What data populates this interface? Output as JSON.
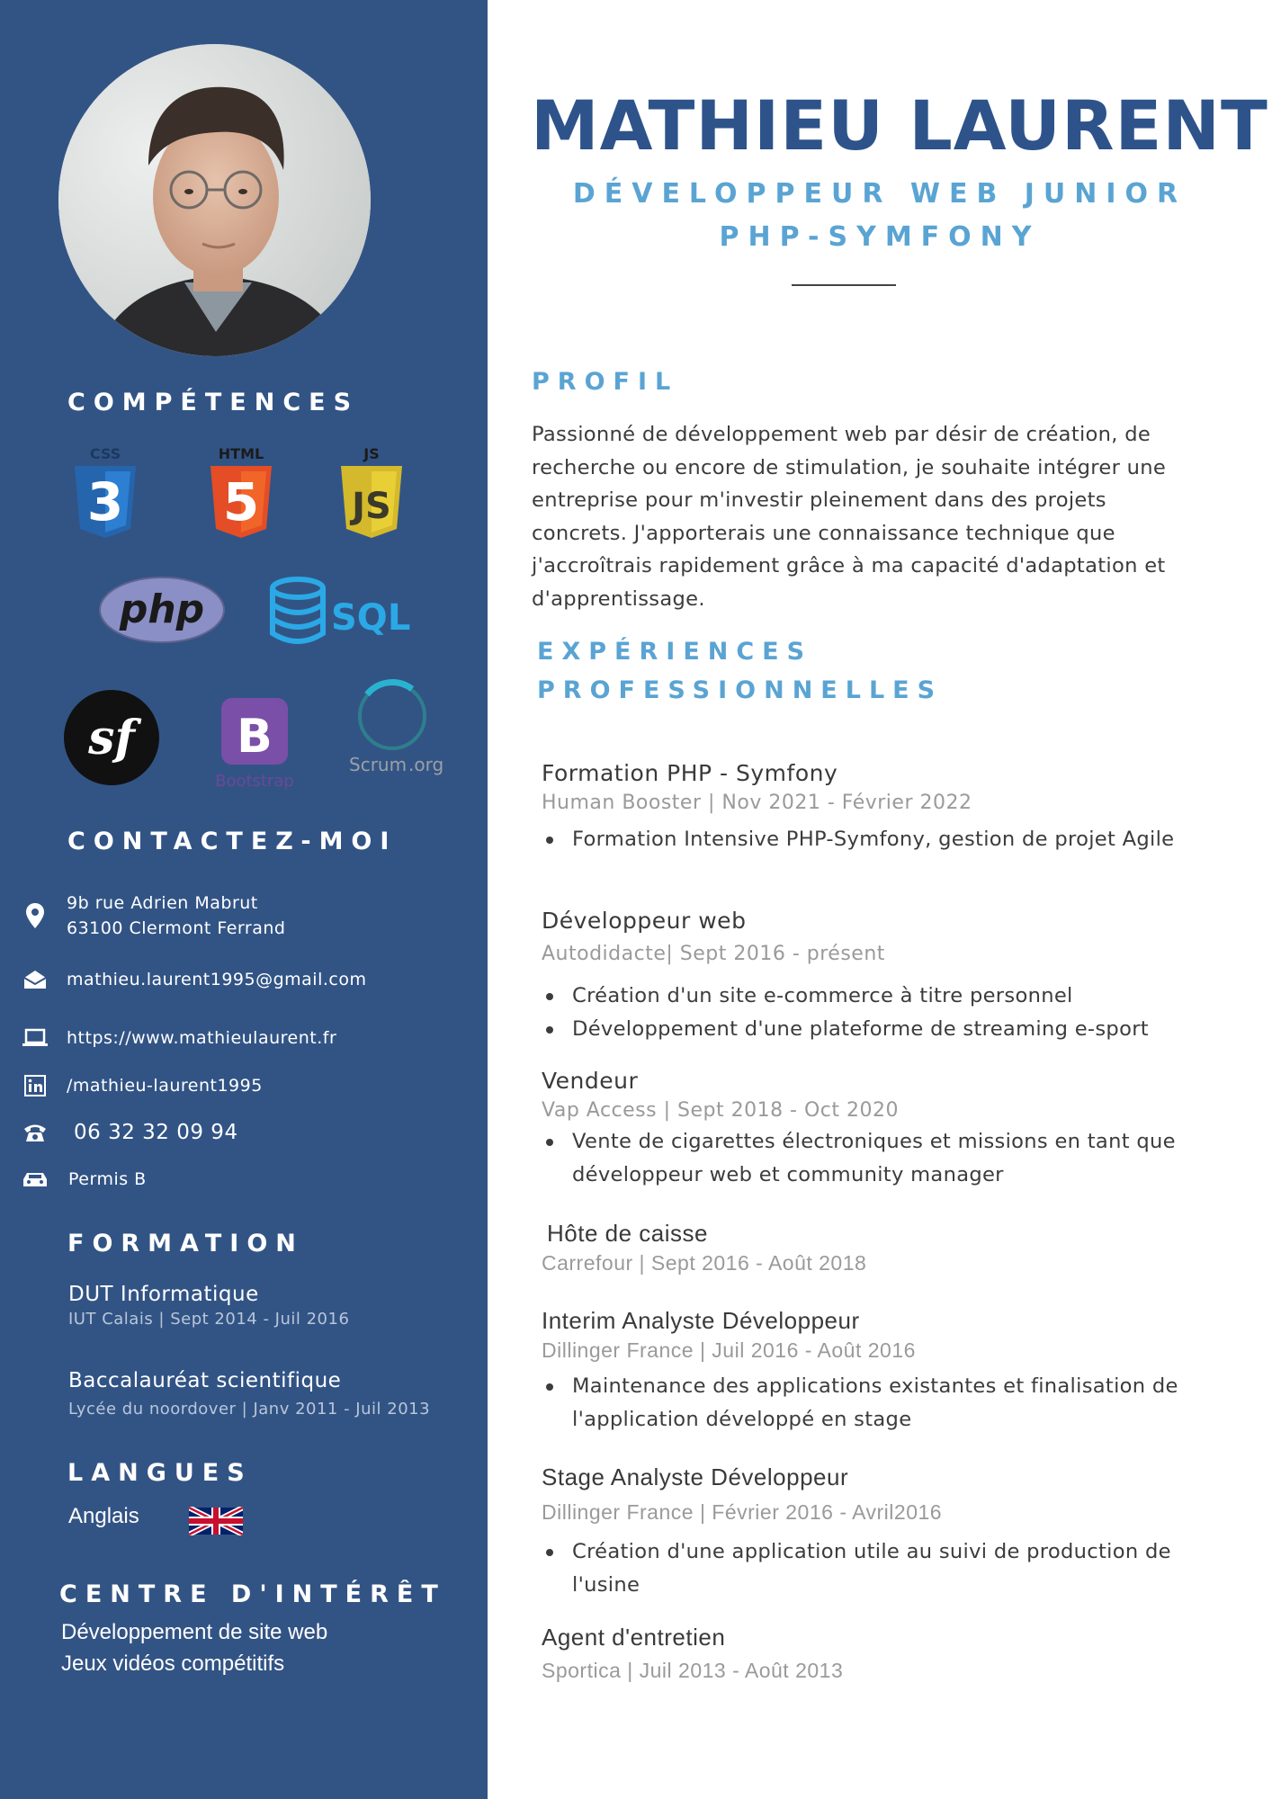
{
  "header": {
    "name": "MATHIEU LAURENT",
    "subtitle_line1": "DÉVELOPPEUR WEB JUNIOR",
    "subtitle_line2": "PHP-SYMFONY"
  },
  "sidebar": {
    "competences_heading": "COMPÉTENCES",
    "logos": {
      "css_label": "CSS",
      "css_digit": "3",
      "html_label": "HTML",
      "html_digit": "5",
      "js_label": "JS",
      "js_mark": "JS",
      "php": "php",
      "sql": "SQL",
      "symfony": "sf",
      "bootstrap_letter": "B",
      "bootstrap_word": "Bootstrap",
      "scrum": "Scrum",
      "scrum_suffix": ".org"
    },
    "contact_heading": "CONTACTEZ-MOI",
    "contact": {
      "address_line1": "9b rue Adrien Mabrut",
      "address_line2": "63100 Clermont Ferrand",
      "email": "mathieu.laurent1995@gmail.com",
      "website": "https://www.mathieulaurent.fr",
      "linkedin": "/mathieu-laurent1995",
      "phone": "06 32 32 09 94",
      "licence": "Permis B"
    },
    "formation_heading": "FORMATION",
    "formation": [
      {
        "title": "DUT Informatique",
        "sub": "IUT Calais | Sept 2014 - Juil 2016"
      },
      {
        "title": "Baccalauréat scientifique",
        "sub": "Lycée du noordover | Janv 2011 - Juil 2013"
      }
    ],
    "langues_heading": "LANGUES",
    "langue": "Anglais",
    "interets_heading": "CENTRE D'INTÉRÊT",
    "interets": [
      "Développement de site web",
      "Jeux vidéos compétitifs"
    ]
  },
  "profil": {
    "heading": "PROFIL",
    "text": "Passionné de développement web par désir de création, de recherche ou encore de stimulation, je souhaite intégrer une entreprise pour m'investir pleinement dans des projets concrets. J'apporterais une connaissance technique que j'accroîtrais rapidement grâce à ma capacité d'adaptation et d'apprentissage."
  },
  "experiences": {
    "heading_line1": "EXPÉRIENCES",
    "heading_line2": "PROFESSIONNELLES",
    "jobs": [
      {
        "title": "Formation PHP - Symfony",
        "meta": "Human Booster | Nov 2021 - Février 2022",
        "bullets": [
          "Formation Intensive PHP-Symfony, gestion de projet Agile"
        ]
      },
      {
        "title": "Développeur web",
        "meta": "Autodidacte| Sept 2016 - présent",
        "bullets": [
          "Création d'un site e-commerce à titre personnel",
          "Développement d'une plateforme de streaming e-sport"
        ]
      },
      {
        "title": "Vendeur",
        "meta": "Vap Access | Sept 2018 - Oct 2020",
        "bullets": [
          "Vente de cigarettes électroniques et missions en tant que développeur web et community manager"
        ]
      },
      {
        "title": "Hôte de caisse",
        "meta": "Carrefour | Sept 2016 - Août 2018",
        "bullets": []
      },
      {
        "title": "Interim Analyste Développeur",
        "meta": "Dillinger France | Juil 2016 - Août 2016",
        "bullets": [
          "Maintenance des applications existantes et finalisation de l'application développé en stage"
        ]
      },
      {
        "title": "Stage Analyste Développeur",
        "meta": "Dillinger France | Février 2016 - Avril2016",
        "bullets": [
          "Création d'une application utile au suivi de production de l'usine"
        ]
      },
      {
        "title": "Agent d'entretien",
        "meta": "Sportica | Juil 2013 - Août 2013",
        "bullets": []
      }
    ]
  },
  "colors": {
    "sidebar": "#325485",
    "name": "#2d538a",
    "accent": "#5aa4d3"
  }
}
